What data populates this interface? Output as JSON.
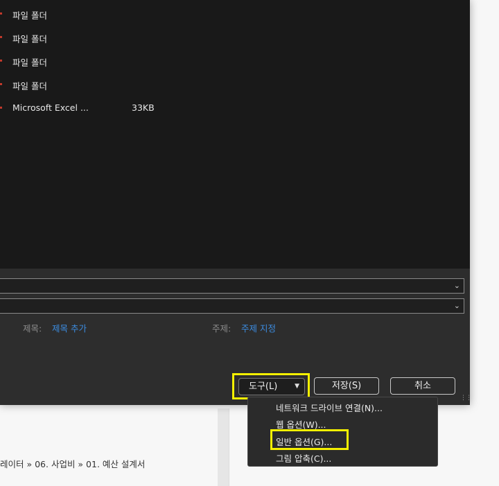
{
  "files": [
    {
      "name": "파일 폴더",
      "size": ""
    },
    {
      "name": "파일 폴더",
      "size": ""
    },
    {
      "name": "파일 폴더",
      "size": ""
    },
    {
      "name": "파일 폴더",
      "size": ""
    },
    {
      "name": "Microsoft Excel ...",
      "size": "33KB"
    }
  ],
  "form": {
    "title_label": "제목:",
    "title_link": "제목 추가",
    "subject_label": "주제:",
    "subject_link": "주제 지정"
  },
  "buttons": {
    "tools": "도구(L)",
    "save": "저장(S)",
    "cancel": "취소"
  },
  "tools_menu": {
    "items": [
      "네트워크 드라이브 연결(N)...",
      "웹 옵션(W)...",
      "일반 옵션(G)...",
      "그림 압축(C)..."
    ]
  },
  "background": {
    "breadcrumb": "레이터 » 06. 사업비 » 01. 예산 설계서"
  },
  "colors": {
    "highlight": "#f5f000",
    "link": "#3c8ce0",
    "dialog_bg": "#2b2b2b"
  }
}
